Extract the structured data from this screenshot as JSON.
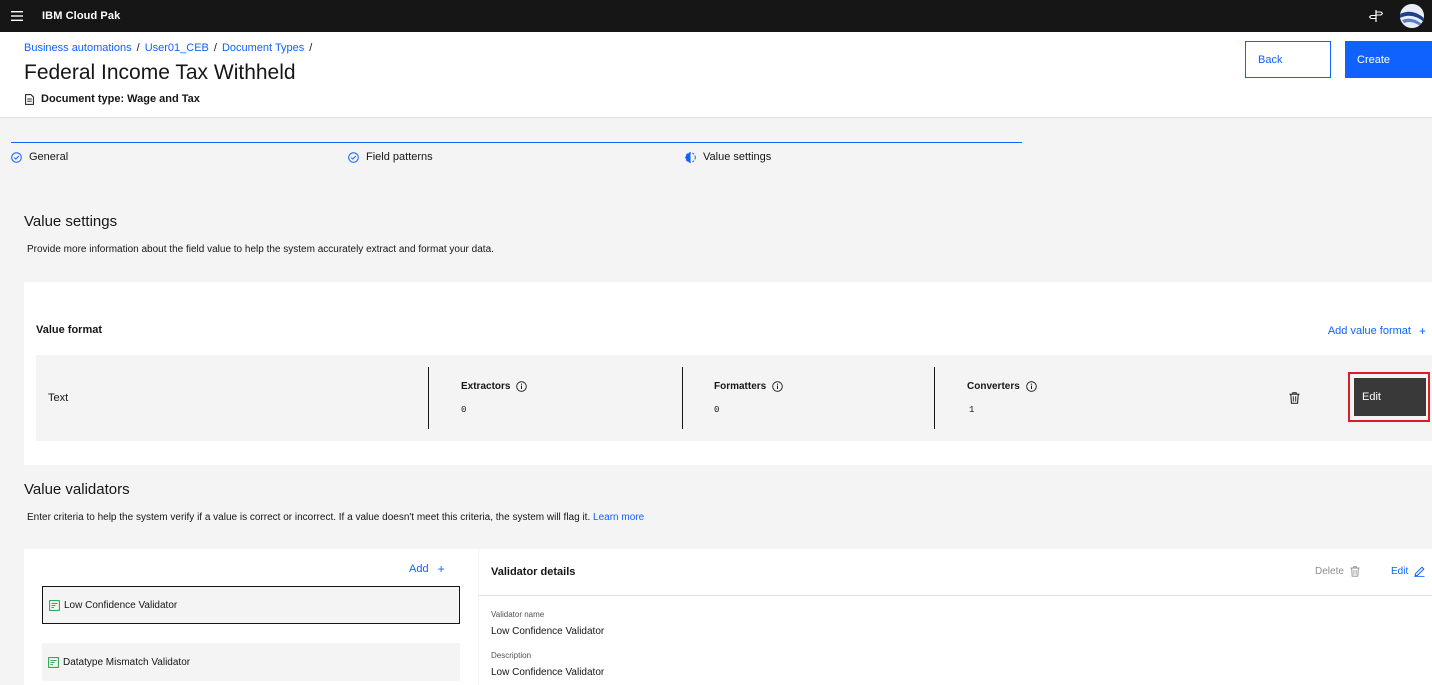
{
  "topbar": {
    "brand": "IBM Cloud Pak"
  },
  "breadcrumb": [
    {
      "label": "Business automations"
    },
    {
      "label": "User01_CEB"
    },
    {
      "label": "Document Types"
    }
  ],
  "breadcrumb_separator": "/",
  "page": {
    "title": "Federal Income Tax Withheld",
    "document_type": "Document type: Wage and Tax"
  },
  "actions": {
    "back_label": "Back",
    "create_label": "Create"
  },
  "progress": {
    "steps": [
      {
        "label": "General",
        "status": "complete"
      },
      {
        "label": "Field patterns",
        "status": "complete"
      },
      {
        "label": "Value settings",
        "status": "current"
      }
    ]
  },
  "value_settings": {
    "title": "Value settings",
    "description": "Provide more information about the field value to help the system accurately extract and format your data."
  },
  "value_format": {
    "title": "Value format",
    "add_label": "Add value format",
    "row": {
      "type": "Text",
      "extractors_label": "Extractors",
      "extractors_value": "0",
      "formatters_label": "Formatters",
      "formatters_value": "0",
      "converters_label": "Converters",
      "converters_value": "1",
      "edit_label": "Edit"
    }
  },
  "value_validators": {
    "title": "Value validators",
    "description": "Enter criteria to help the system verify if a value is correct or incorrect. If a value doesn't meet this criteria, the system will flag it.",
    "learn_more": "Learn more",
    "add_label": "Add",
    "items": [
      {
        "label": "Low Confidence Validator"
      },
      {
        "label": "Datatype Mismatch Validator"
      }
    ]
  },
  "validator_details": {
    "title": "Validator details",
    "delete_label": "Delete",
    "edit_label": "Edit",
    "name_label": "Validator name",
    "name_value": "Low Confidence Validator",
    "description_label": "Description",
    "description_value": "Low Confidence Validator"
  },
  "colors": {
    "primary": "#0f62fe",
    "topbar": "#161616",
    "highlight": "#da1e28",
    "edit_button": "#393939"
  }
}
